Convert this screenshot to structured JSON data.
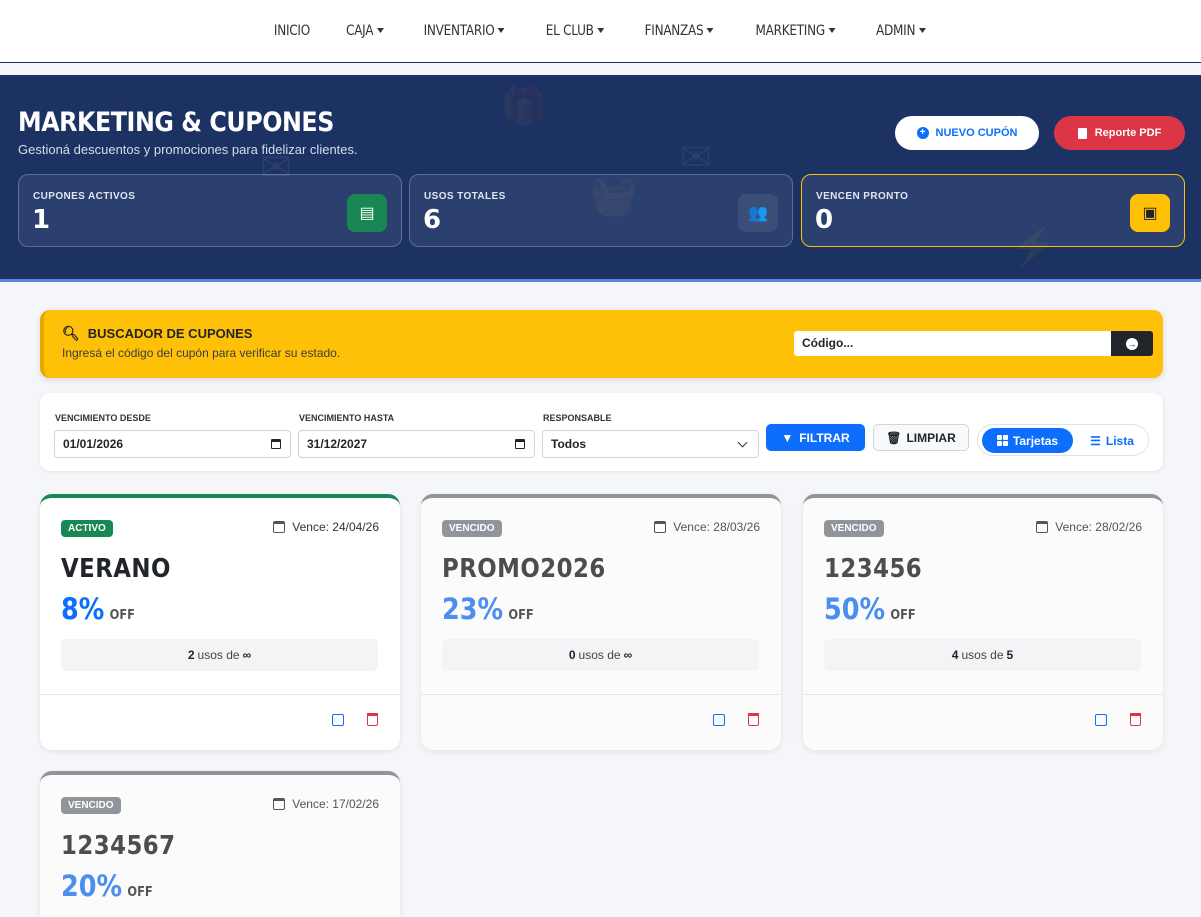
{
  "nav": {
    "items": [
      {
        "label": "INICIO",
        "dropdown": false
      },
      {
        "label": "CAJA",
        "dropdown": true
      },
      {
        "label": "INVENTARIO",
        "dropdown": true
      },
      {
        "label": "EL CLUB",
        "dropdown": true
      },
      {
        "label": "FINANZAS",
        "dropdown": true
      },
      {
        "label": "MARKETING",
        "dropdown": true
      },
      {
        "label": "ADMIN",
        "dropdown": true
      }
    ]
  },
  "hero": {
    "title": "MARKETING & CUPONES",
    "subtitle": "Gestioná descuentos y promociones para fidelizar clientes.",
    "new_button": "NUEVO CUPÓN",
    "pdf_button": "Reporte PDF"
  },
  "stats": [
    {
      "label": "CUPONES ACTIVOS",
      "value": "1",
      "icon": "ticket-icon",
      "color": "#198754"
    },
    {
      "label": "USOS TOTALES",
      "value": "6",
      "icon": "users-icon",
      "color": "#3a4f78"
    },
    {
      "label": "VENCEN PRONTO",
      "value": "0",
      "icon": "calendar-x-icon",
      "color": "#ffc107"
    }
  ],
  "search": {
    "title": "BUSCADOR DE CUPONES",
    "description": "Ingresá el código del cupón para verificar su estado.",
    "placeholder": "Código..."
  },
  "filters": {
    "from_label": "VENCIMIENTO DESDE",
    "from_value": "01/01/2026",
    "to_label": "VENCIMIENTO HASTA",
    "to_value": "31/12/2027",
    "resp_label": "RESPONSABLE",
    "resp_value": "Todos",
    "filter_button": "FILTRAR",
    "clear_button": "LIMPIAR",
    "view_cards": "Tarjetas",
    "view_list": "Lista"
  },
  "coupons": [
    {
      "status": "ACTIVO",
      "expires": "Vence: 24/04/26",
      "code": "VERANO",
      "discount": "8%",
      "off": "OFF",
      "uses": "2",
      "uses_of": "usos de",
      "max": "∞"
    },
    {
      "status": "VENCIDO",
      "expires": "Vence: 28/03/26",
      "code": "PROMO2026",
      "discount": "23%",
      "off": "OFF",
      "uses": "0",
      "uses_of": "usos de",
      "max": "∞"
    },
    {
      "status": "VENCIDO",
      "expires": "Vence: 28/02/26",
      "code": "123456",
      "discount": "50%",
      "off": "OFF",
      "uses": "4",
      "uses_of": "usos de",
      "max": "5"
    },
    {
      "status": "VENCIDO",
      "expires": "Vence: 17/02/26",
      "code": "1234567",
      "discount": "20%",
      "off": "OFF",
      "uses": "",
      "uses_of": "",
      "max": ""
    }
  ]
}
